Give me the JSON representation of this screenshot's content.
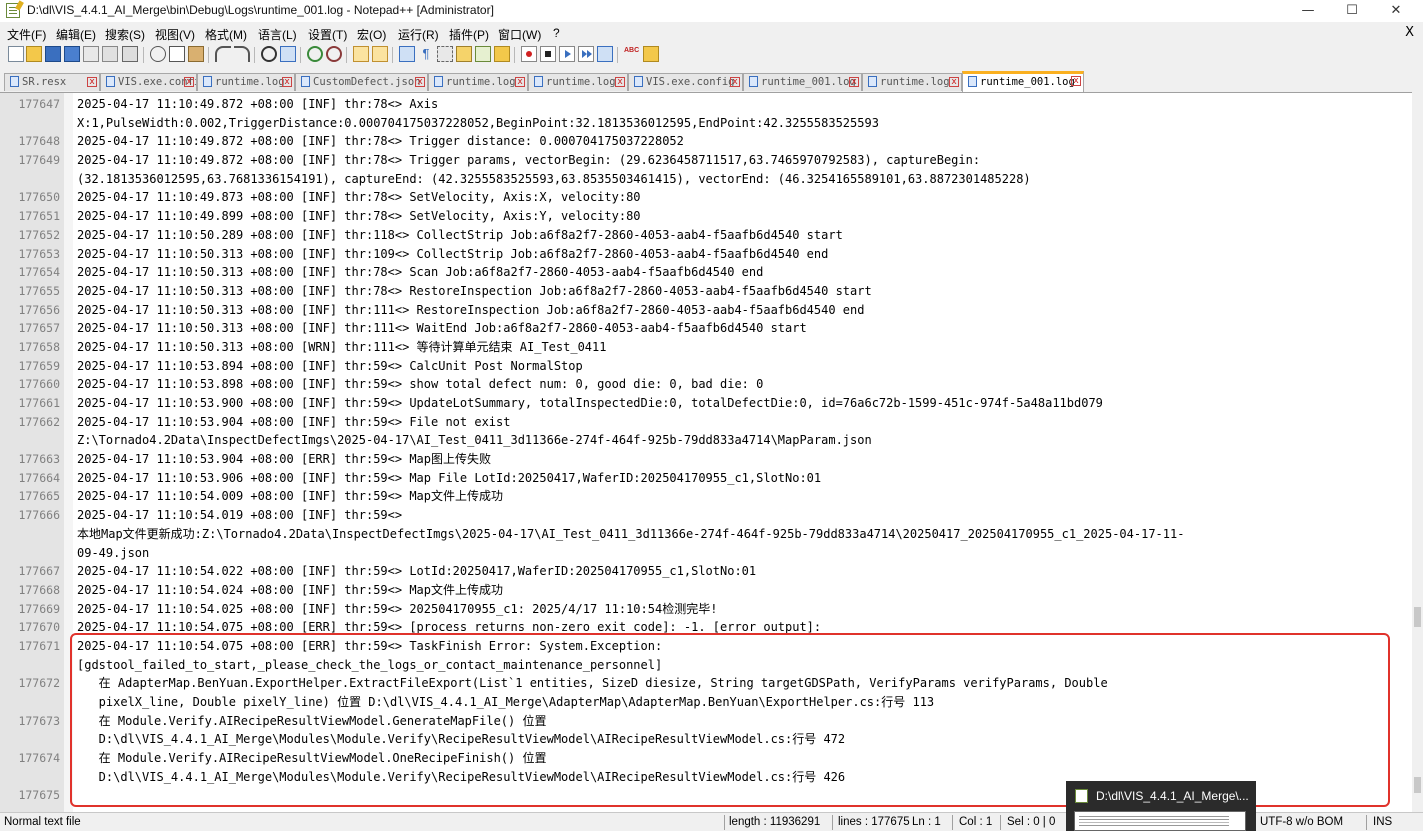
{
  "window": {
    "title": "D:\\dl\\VIS_4.4.1_AI_Merge\\bin\\Debug\\Logs\\runtime_001.log - Notepad++ [Administrator]",
    "minimize": "—",
    "maximize": "☐",
    "close": "✕"
  },
  "menu": {
    "items": [
      "文件(F)",
      "编辑(E)",
      "搜索(S)",
      "视图(V)",
      "格式(M)",
      "语言(L)",
      "设置(T)",
      "宏(O)",
      "运行(R)",
      "插件(P)",
      "窗口(W)",
      "?"
    ],
    "close": "X"
  },
  "toolbar": {
    "icons": [
      "new-file-icon",
      "open-file-icon",
      "save-icon",
      "save-all-icon",
      "close-icon",
      "close-all-icon",
      "print-icon",
      "cut-icon",
      "copy-icon",
      "paste-icon",
      "undo-icon",
      "redo-icon",
      "find-icon",
      "replace-icon",
      "zoom-in-icon",
      "zoom-out-icon",
      "sync-v-icon",
      "sync-h-icon",
      "word-wrap-icon",
      "show-all-chars-icon",
      "indent-guide-icon",
      "doc-map-icon",
      "function-list-icon",
      "folder-workspace-icon",
      "record-macro-icon",
      "stop-macro-icon",
      "play-macro-icon",
      "run-macro-multiple-icon",
      "save-macro-icon",
      "spellcheck-icon",
      "plugin-icon"
    ]
  },
  "tabs": [
    {
      "label": "SR.resx"
    },
    {
      "label": "VIS.exe.config"
    },
    {
      "label": "runtime.log"
    },
    {
      "label": "CustomDefect.json"
    },
    {
      "label": "runtime.log"
    },
    {
      "label": "runtime.log"
    },
    {
      "label": "VIS.exe.config"
    },
    {
      "label": "runtime_001.log"
    },
    {
      "label": "runtime.log"
    },
    {
      "label": "runtime_001.log",
      "active": true
    }
  ],
  "editor": {
    "lines": [
      {
        "n": "177647",
        "t": "2025-04-17 11:10:49.872 +08:00 [INF] thr:78<> Axis"
      },
      {
        "n": "",
        "t": "X:1,PulseWidth:0.002,TriggerDistance:0.000704175037228052,BeginPoint:32.1813536012595,EndPoint:42.3255583525593"
      },
      {
        "n": "177648",
        "t": "2025-04-17 11:10:49.872 +08:00 [INF] thr:78<> Trigger distance: 0.000704175037228052"
      },
      {
        "n": "177649",
        "t": "2025-04-17 11:10:49.872 +08:00 [INF] thr:78<> Trigger params, vectorBegin: (29.6236458711517,63.7465970792583), captureBegin:"
      },
      {
        "n": "",
        "t": "(32.1813536012595,63.7681336154191), captureEnd: (42.3255583525593,63.8535503461415), vectorEnd: (46.3254165589101,63.8872301485228)"
      },
      {
        "n": "177650",
        "t": "2025-04-17 11:10:49.873 +08:00 [INF] thr:78<> SetVelocity, Axis:X, velocity:80"
      },
      {
        "n": "177651",
        "t": "2025-04-17 11:10:49.899 +08:00 [INF] thr:78<> SetVelocity, Axis:Y, velocity:80"
      },
      {
        "n": "177652",
        "t": "2025-04-17 11:10:50.289 +08:00 [INF] thr:118<> CollectStrip Job:a6f8a2f7-2860-4053-aab4-f5aafb6d4540 start"
      },
      {
        "n": "177653",
        "t": "2025-04-17 11:10:50.313 +08:00 [INF] thr:109<> CollectStrip Job:a6f8a2f7-2860-4053-aab4-f5aafb6d4540 end"
      },
      {
        "n": "177654",
        "t": "2025-04-17 11:10:50.313 +08:00 [INF] thr:78<> Scan Job:a6f8a2f7-2860-4053-aab4-f5aafb6d4540 end"
      },
      {
        "n": "177655",
        "t": "2025-04-17 11:10:50.313 +08:00 [INF] thr:78<> RestoreInspection Job:a6f8a2f7-2860-4053-aab4-f5aafb6d4540 start"
      },
      {
        "n": "177656",
        "t": "2025-04-17 11:10:50.313 +08:00 [INF] thr:111<> RestoreInspection Job:a6f8a2f7-2860-4053-aab4-f5aafb6d4540 end"
      },
      {
        "n": "177657",
        "t": "2025-04-17 11:10:50.313 +08:00 [INF] thr:111<> WaitEnd Job:a6f8a2f7-2860-4053-aab4-f5aafb6d4540 start"
      },
      {
        "n": "177658",
        "t": "2025-04-17 11:10:50.313 +08:00 [WRN] thr:111<> 等待计算单元结束 AI_Test_0411"
      },
      {
        "n": "177659",
        "t": "2025-04-17 11:10:53.894 +08:00 [INF] thr:59<> CalcUnit Post NormalStop"
      },
      {
        "n": "177660",
        "t": "2025-04-17 11:10:53.898 +08:00 [INF] thr:59<> show total defect num: 0, good die: 0, bad die: 0"
      },
      {
        "n": "177661",
        "t": "2025-04-17 11:10:53.900 +08:00 [INF] thr:59<> UpdateLotSummary, totalInspectedDie:0, totalDefectDie:0, id=76a6c72b-1599-451c-974f-5a48a11bd079"
      },
      {
        "n": "177662",
        "t": "2025-04-17 11:10:53.904 +08:00 [INF] thr:59<> File not exist"
      },
      {
        "n": "",
        "t": "Z:\\Tornado4.2Data\\InspectDefectImgs\\2025-04-17\\AI_Test_0411_3d11366e-274f-464f-925b-79dd833a4714\\MapParam.json"
      },
      {
        "n": "177663",
        "t": "2025-04-17 11:10:53.904 +08:00 [ERR] thr:59<> Map图上传失败"
      },
      {
        "n": "177664",
        "t": "2025-04-17 11:10:53.906 +08:00 [INF] thr:59<> Map File LotId:20250417,WaferID:202504170955_c1,SlotNo:01"
      },
      {
        "n": "177665",
        "t": "2025-04-17 11:10:54.009 +08:00 [INF] thr:59<> Map文件上传成功"
      },
      {
        "n": "177666",
        "t": "2025-04-17 11:10:54.019 +08:00 [INF] thr:59<>"
      },
      {
        "n": "",
        "t": "本地Map文件更新成功:Z:\\Tornado4.2Data\\InspectDefectImgs\\2025-04-17\\AI_Test_0411_3d11366e-274f-464f-925b-79dd833a4714\\20250417_202504170955_c1_2025-04-17-11-"
      },
      {
        "n": "",
        "t": "09-49.json"
      },
      {
        "n": "177667",
        "t": "2025-04-17 11:10:54.022 +08:00 [INF] thr:59<> LotId:20250417,WaferID:202504170955_c1,SlotNo:01"
      },
      {
        "n": "177668",
        "t": "2025-04-17 11:10:54.024 +08:00 [INF] thr:59<> Map文件上传成功"
      },
      {
        "n": "177669",
        "t": "2025-04-17 11:10:54.025 +08:00 [INF] thr:59<> 202504170955_c1: 2025/4/17 11:10:54检测完毕!"
      },
      {
        "n": "177670",
        "t": "2025-04-17 11:10:54.075 +08:00 [ERR] thr:59<> [process returns non-zero exit code]: -1. [error output]:"
      },
      {
        "n": "177671",
        "t": "2025-04-17 11:10:54.075 +08:00 [ERR] thr:59<> TaskFinish Error: System.Exception:"
      },
      {
        "n": "",
        "t": "[gdstool_failed_to_start,_please_check_the_logs_or_contact_maintenance_personnel]"
      },
      {
        "n": "177672",
        "t": "   在 AdapterMap.BenYuan.ExportHelper.ExtractFileExport(List`1 entities, SizeD diesize, String targetGDSPath, VerifyParams verifyParams, Double"
      },
      {
        "n": "",
        "t": "   pixelX_line, Double pixelY_line) 位置 D:\\dl\\VIS_4.4.1_AI_Merge\\AdapterMap\\AdapterMap.BenYuan\\ExportHelper.cs:行号 113"
      },
      {
        "n": "177673",
        "t": "   在 Module.Verify.AIRecipeResultViewModel.GenerateMapFile() 位置"
      },
      {
        "n": "",
        "t": "   D:\\dl\\VIS_4.4.1_AI_Merge\\Modules\\Module.Verify\\RecipeResultViewModel\\AIRecipeResultViewModel.cs:行号 472"
      },
      {
        "n": "177674",
        "t": "   在 Module.Verify.AIRecipeResultViewModel.OneRecipeFinish() 位置"
      },
      {
        "n": "",
        "t": "   D:\\dl\\VIS_4.4.1_AI_Merge\\Modules\\Module.Verify\\RecipeResultViewModel\\AIRecipeResultViewModel.cs:行号 426"
      },
      {
        "n": "177675",
        "t": ""
      }
    ]
  },
  "status": {
    "filetype": "Normal text file",
    "length": "length : 11936291",
    "lines": "lines : 177675",
    "ln": "Ln : 1",
    "col": "Col : 1",
    "sel": "Sel : 0 | 0",
    "encoding": "UTF-8 w/o BOM",
    "ins": "INS"
  },
  "taskbar_preview": {
    "label": "D:\\dl\\VIS_4.4.1_AI_Merge\\..."
  },
  "colors": {
    "highlight_border": "#e0322b",
    "active_tab_accent": "#fab020"
  }
}
